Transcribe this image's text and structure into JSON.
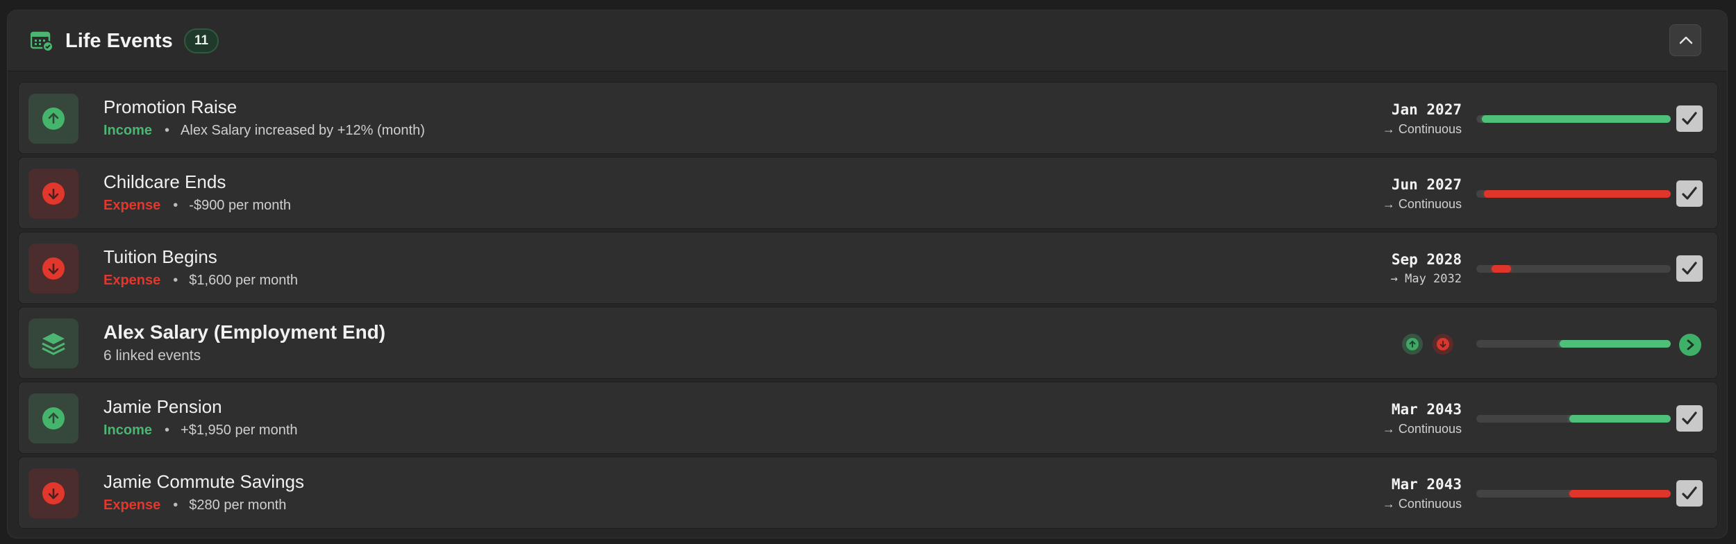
{
  "header": {
    "title": "Life Events",
    "count": "11",
    "icons": {
      "calendar": "calendar-icon",
      "collapse": "chevron-up-icon"
    }
  },
  "colors": {
    "income": "#4cb572",
    "expense": "#e5362c",
    "accent_green": "#4fc07a",
    "panel": "#262626",
    "row": "#2f2f2f"
  },
  "events": [
    {
      "name": "Promotion Raise",
      "kind": "Income",
      "detail": "Alex Salary increased by +12% (month)",
      "start": "Jan 2027",
      "end": "→ Continuous",
      "direction": "up",
      "checked": true,
      "timeline": {
        "start": 0.03,
        "end": 1.0,
        "color": "green"
      }
    },
    {
      "name": "Childcare Ends",
      "kind": "Expense",
      "detail": "-$900 per month",
      "start": "Jun 2027",
      "end": "→ Continuous",
      "direction": "down",
      "checked": true,
      "timeline": {
        "start": 0.04,
        "end": 1.0,
        "color": "red"
      }
    },
    {
      "name": "Tuition Begins",
      "kind": "Expense",
      "detail": "$1,600 per month",
      "start": "Sep 2028",
      "end": "→ May 2032",
      "direction": "down",
      "checked": true,
      "timeline": {
        "start": 0.08,
        "end": 0.18,
        "color": "red"
      }
    },
    {
      "name": "Jamie Pension",
      "kind": "Income",
      "detail": "+$1,950 per month",
      "start": "Mar 2043",
      "end": "→ Continuous",
      "direction": "up",
      "checked": true,
      "timeline": {
        "start": 0.48,
        "end": 1.0,
        "color": "green"
      }
    },
    {
      "name": "Jamie Commute Savings",
      "kind": "Expense",
      "detail": "$280 per month",
      "start": "Mar 2043",
      "end": "→ Continuous",
      "direction": "down",
      "checked": true,
      "timeline": {
        "start": 0.48,
        "end": 1.0,
        "color": "red"
      }
    }
  ],
  "group": {
    "name": "Alex Salary (Employment End)",
    "linked": "6 linked events",
    "icon": "layers-icon",
    "badges": [
      "arrow-up-icon",
      "arrow-down-icon"
    ],
    "timeline": {
      "start": 0.43,
      "end": 1.0,
      "color": "green"
    }
  }
}
